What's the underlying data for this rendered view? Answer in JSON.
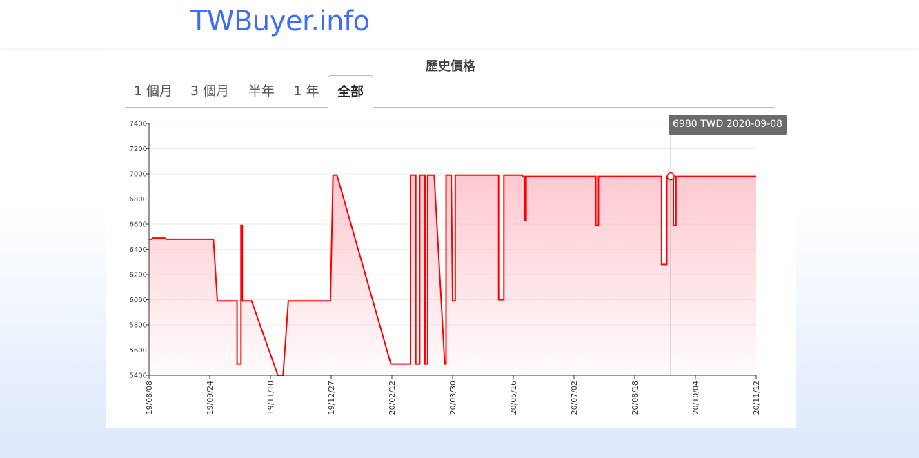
{
  "header": {
    "logo": "TWBuyer.info"
  },
  "page": {
    "title": "歷史價格"
  },
  "tabs": [
    {
      "label": "1 個月",
      "active": false
    },
    {
      "label": "3 個月",
      "active": false
    },
    {
      "label": "半年",
      "active": false
    },
    {
      "label": "1 年",
      "active": false
    },
    {
      "label": "全部",
      "active": true
    }
  ],
  "tooltip": {
    "text": "6980 TWD 2020-09-08"
  },
  "colors": {
    "accent": "#3f6ef3",
    "line": "#ff0000",
    "fill": "#ffb6c1"
  },
  "chart_data": {
    "type": "area",
    "ylim": [
      5400,
      7400
    ],
    "yticks": [
      5400,
      5600,
      5800,
      6000,
      6200,
      6400,
      6600,
      6800,
      7000,
      7200,
      7400
    ],
    "xlim": [
      "2019-08-08",
      "2020-11-12"
    ],
    "xticks": [
      "19/08/08",
      "19/09/24",
      "19/11/10",
      "19/12/27",
      "20/02/12",
      "20/03/30",
      "20/05/16",
      "20/07/02",
      "20/08/18",
      "20/10/04",
      "20/11/12"
    ],
    "grid": true,
    "highlight": {
      "date": "2020-09-08",
      "value": 6980
    },
    "points": [
      [
        "2019-08-08",
        6480
      ],
      [
        "2019-08-10",
        6480
      ],
      [
        "2019-08-11",
        6490
      ],
      [
        "2019-08-20",
        6490
      ],
      [
        "2019-08-21",
        6480
      ],
      [
        "2019-09-26",
        6480
      ],
      [
        "2019-09-29",
        5990
      ],
      [
        "2019-10-14",
        5990
      ],
      [
        "2019-10-14",
        5490
      ],
      [
        "2019-10-17",
        5490
      ],
      [
        "2019-10-17",
        6590
      ],
      [
        "2019-10-18",
        6590
      ],
      [
        "2019-10-18",
        5990
      ],
      [
        "2019-10-25",
        5990
      ],
      [
        "2019-11-14",
        5400
      ],
      [
        "2019-11-18",
        5400
      ],
      [
        "2019-11-22",
        5990
      ],
      [
        "2019-12-24",
        5990
      ],
      [
        "2019-12-26",
        6990
      ],
      [
        "2019-12-29",
        6990
      ],
      [
        "2020-02-08",
        5490
      ],
      [
        "2020-02-23",
        5490
      ],
      [
        "2020-02-23",
        6990
      ],
      [
        "2020-02-27",
        6990
      ],
      [
        "2020-02-27",
        5490
      ],
      [
        "2020-03-01",
        5490
      ],
      [
        "2020-03-01",
        6990
      ],
      [
        "2020-03-05",
        6990
      ],
      [
        "2020-03-05",
        5490
      ],
      [
        "2020-03-07",
        5490
      ],
      [
        "2020-03-07",
        6990
      ],
      [
        "2020-03-12",
        6990
      ],
      [
        "2020-03-20",
        5490
      ],
      [
        "2020-03-21",
        5490
      ],
      [
        "2020-03-21",
        6990
      ],
      [
        "2020-03-25",
        6990
      ],
      [
        "2020-03-26",
        5990
      ],
      [
        "2020-03-28",
        5990
      ],
      [
        "2020-03-28",
        6990
      ],
      [
        "2020-04-25",
        6990
      ],
      [
        "2020-04-30",
        6990
      ],
      [
        "2020-04-30",
        6000
      ],
      [
        "2020-05-04",
        6000
      ],
      [
        "2020-05-04",
        6990
      ],
      [
        "2020-05-14",
        6990
      ],
      [
        "2020-05-18",
        6990
      ],
      [
        "2020-05-18",
        6980
      ],
      [
        "2020-05-20",
        6980
      ],
      [
        "2020-05-20",
        6630
      ],
      [
        "2020-05-21",
        6630
      ],
      [
        "2020-05-21",
        6980
      ],
      [
        "2020-07-13",
        6980
      ],
      [
        "2020-07-13",
        6590
      ],
      [
        "2020-07-15",
        6590
      ],
      [
        "2020-07-15",
        6980
      ],
      [
        "2020-08-28",
        6980
      ],
      [
        "2020-09-01",
        6980
      ],
      [
        "2020-09-01",
        6280
      ],
      [
        "2020-09-05",
        6280
      ],
      [
        "2020-09-05",
        6980
      ],
      [
        "2020-09-08",
        6980
      ],
      [
        "2020-09-10",
        6980
      ],
      [
        "2020-09-10",
        6590
      ],
      [
        "2020-09-12",
        6590
      ],
      [
        "2020-09-12",
        6980
      ],
      [
        "2020-11-12",
        6980
      ]
    ]
  }
}
